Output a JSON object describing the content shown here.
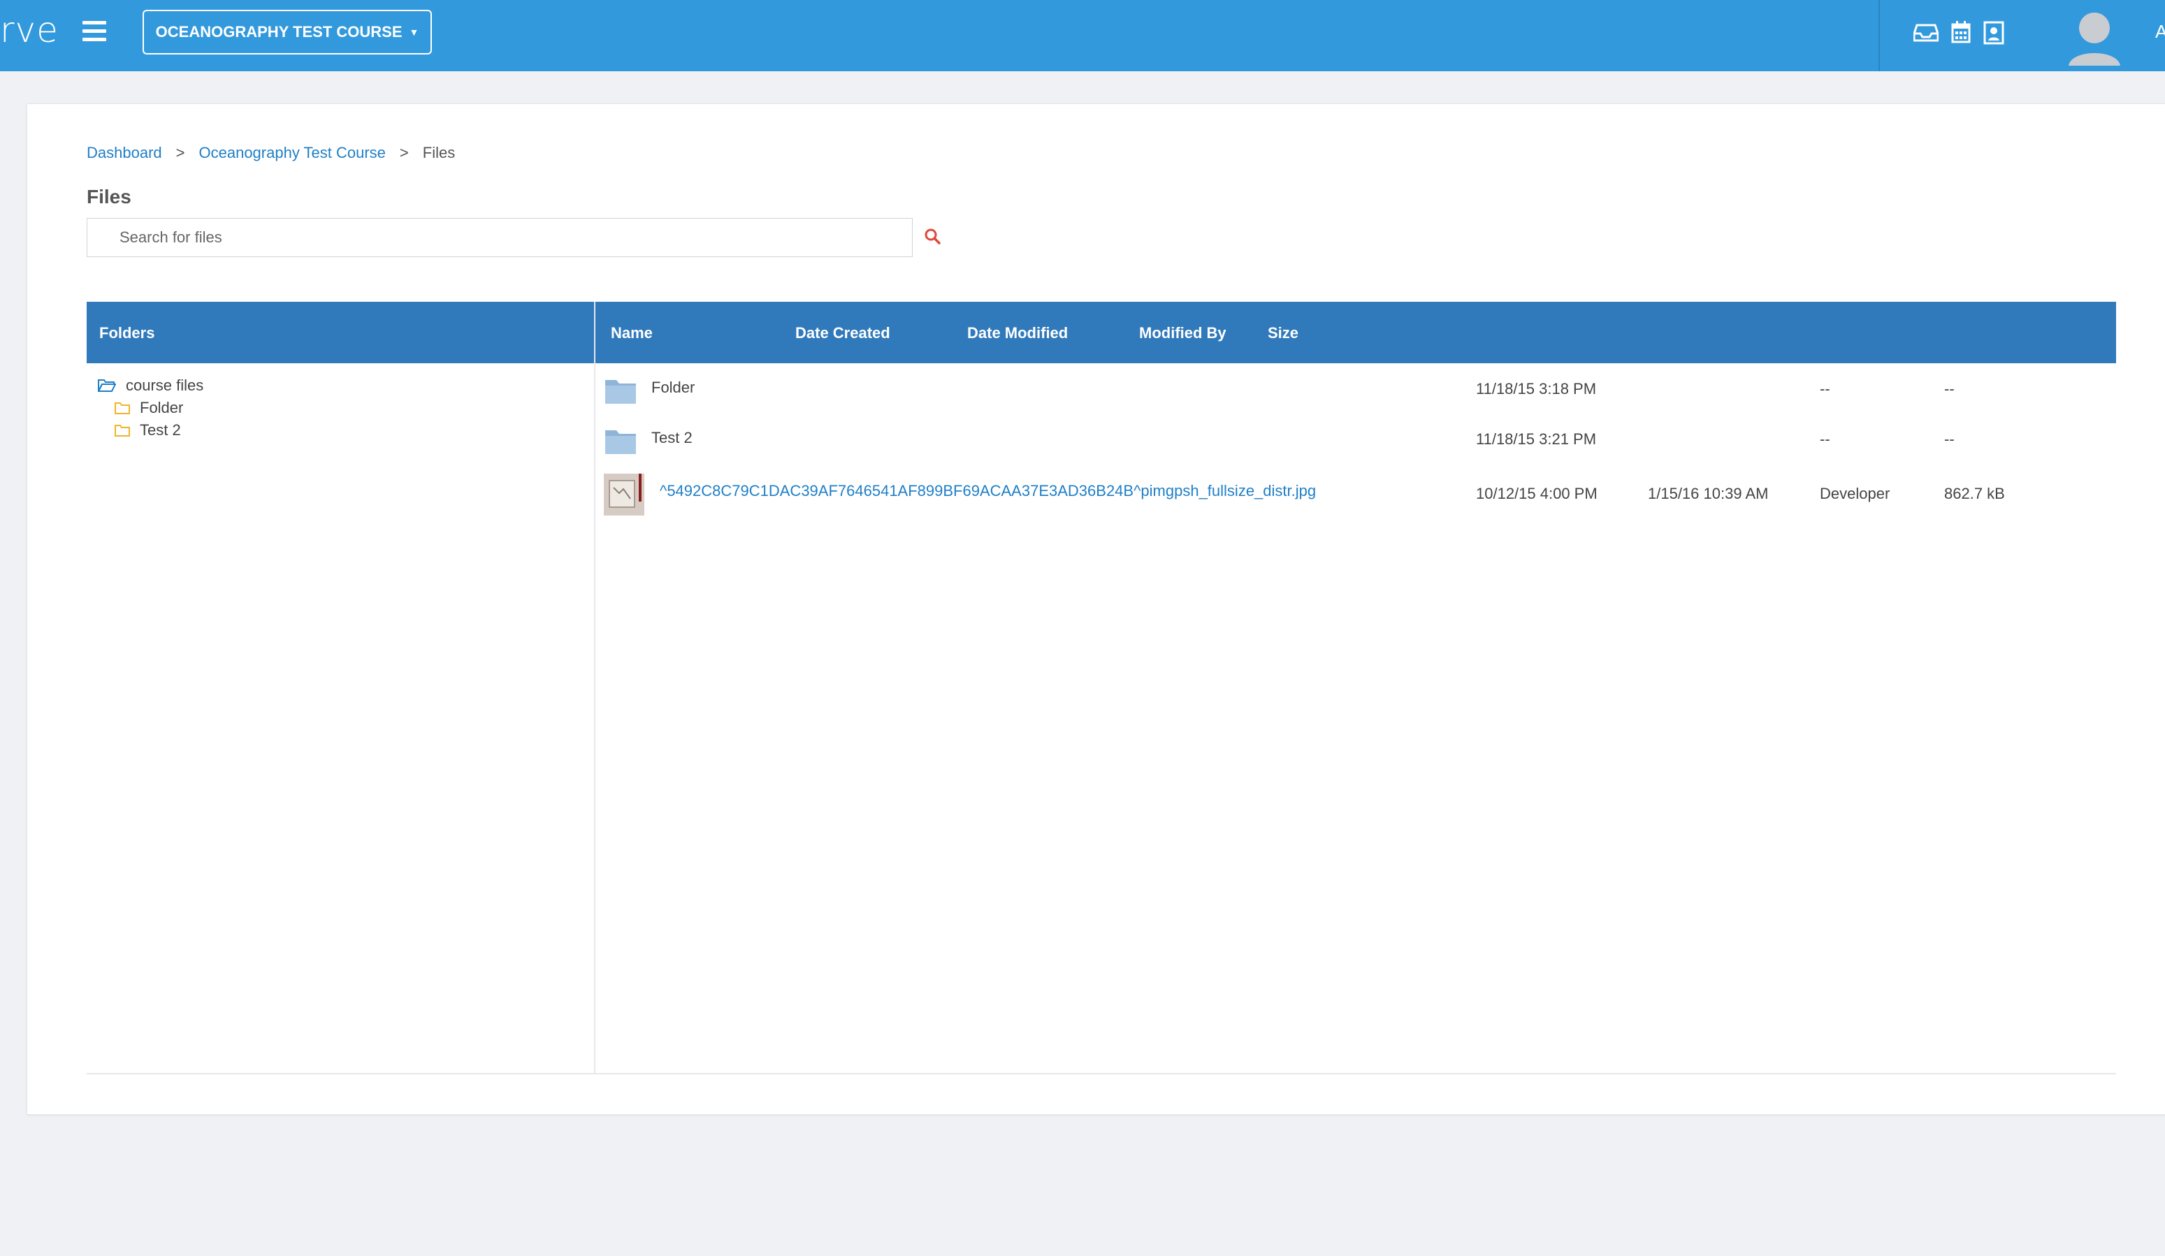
{
  "app": {
    "logo_text": "rve",
    "course_button": "OCEANOGRAPHY TEST COURSE",
    "user_initial": "A",
    "icons": [
      "menu-icon",
      "inbox-icon",
      "calendar-icon",
      "gradebook-icon",
      "user-avatar-icon"
    ]
  },
  "breadcrumb": {
    "items": [
      "Dashboard",
      "Oceanography Test Course"
    ],
    "separator": ">",
    "current": "Files"
  },
  "page": {
    "title": "Files",
    "search_placeholder": "Search for files"
  },
  "table": {
    "folders_header": "Folders",
    "columns": [
      "Name",
      "Date Created",
      "Date Modified",
      "Modified By",
      "Size"
    ]
  },
  "folder_tree": {
    "root": "course files",
    "children": [
      "Folder",
      "Test 2"
    ]
  },
  "files": [
    {
      "name": "Folder",
      "type": "folder",
      "date_created": "11/18/15 3:18 PM",
      "date_modified": "",
      "modified_by": "--",
      "size": "--"
    },
    {
      "name": "Test 2",
      "type": "folder",
      "date_created": "11/18/15 3:21 PM",
      "date_modified": "",
      "modified_by": "--",
      "size": "--"
    },
    {
      "name": "^5492C8C79C1DAC39AF7646541AF899BF69ACAA37E3AD36B24B^pimgpsh_fullsize_distr.jpg",
      "type": "image",
      "date_created": "10/12/15 4:00 PM",
      "date_modified": "1/15/16 10:39 AM",
      "modified_by": "Developer",
      "size": "862.7 kB"
    }
  ],
  "colors": {
    "topbar": "#3399dd",
    "table_header": "#3079bb",
    "link": "#1f7fc7",
    "search_icon": "#e0473a"
  }
}
